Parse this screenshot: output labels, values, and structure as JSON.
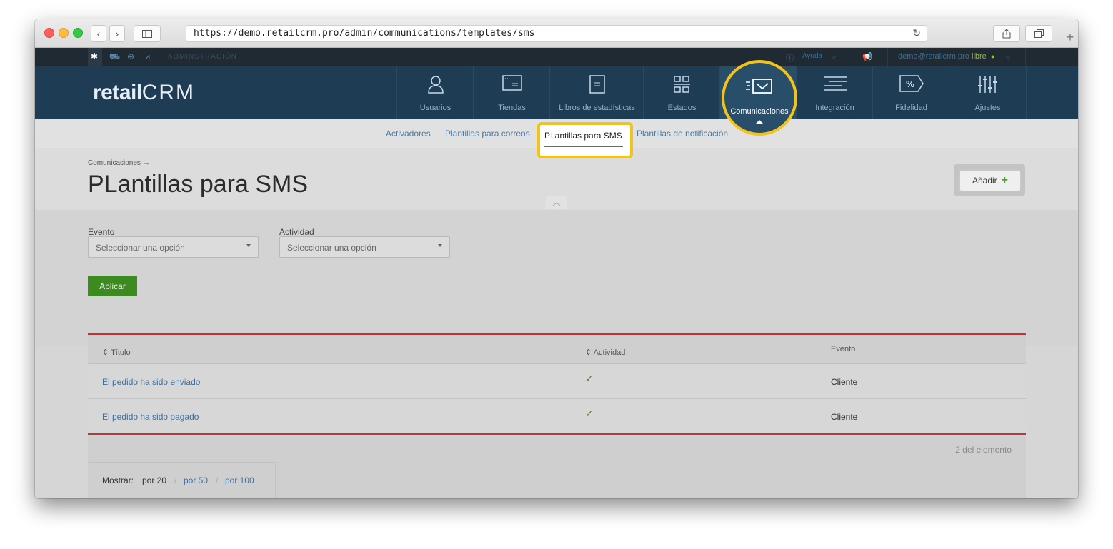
{
  "browser": {
    "url": "https://demo.retailcrm.pro/admin/communications/templates/sms"
  },
  "admin_bar": {
    "section_label": "ADMINSTRACIÓN",
    "help": "Ayuda",
    "user_email": "demo@retailcrm.pro",
    "user_status": "libre"
  },
  "logo": {
    "left": "retail",
    "right": "CRM"
  },
  "main_nav": {
    "items": [
      {
        "label": "Usuarios",
        "icon": "user-icon"
      },
      {
        "label": "Tiendas",
        "icon": "store-icon"
      },
      {
        "label": "Libros de estadísticas",
        "icon": "book-icon"
      },
      {
        "label": "Estados",
        "icon": "status-icon"
      },
      {
        "label": "Comunicaciones",
        "icon": "mail-icon",
        "active": true
      },
      {
        "label": "Integración",
        "icon": "integration-icon"
      },
      {
        "label": "Fidelidad",
        "icon": "percent-tag-icon"
      },
      {
        "label": "Ajustes",
        "icon": "sliders-icon"
      }
    ]
  },
  "sub_nav": {
    "items": [
      "Activadores",
      "Plantillas para correos",
      "PLantillas para SMS",
      "Plantillas de notificación"
    ],
    "active": "PLantillas para SMS"
  },
  "page": {
    "breadcrumb": "Comunicaciones →",
    "title": "PLantillas para SMS",
    "add_button": "Añadir"
  },
  "filters": {
    "event_label": "Evento",
    "event_value": "Seleccionar una opción",
    "activity_label": "Actividad",
    "activity_value": "Seleccionar una opción",
    "apply_label": "Aplicar"
  },
  "table": {
    "headers": [
      "Título",
      "Actividad",
      "Evento"
    ],
    "rows": [
      {
        "title": "El pedido ha sido enviado",
        "active": true,
        "event": "Cliente"
      },
      {
        "title": "El pedido ha sido pagado",
        "active": true,
        "event": "Cliente"
      }
    ],
    "count_text": "2 del elemento"
  },
  "pagination": {
    "label": "Mostrar:",
    "options": [
      "por 20",
      "por 50",
      "por 100"
    ],
    "current": "por 20"
  },
  "colors": {
    "nav_bg": "#1e3c54",
    "highlight": "#f2c318",
    "accent_red": "#c5303a",
    "apply_green": "#3d8a20"
  }
}
